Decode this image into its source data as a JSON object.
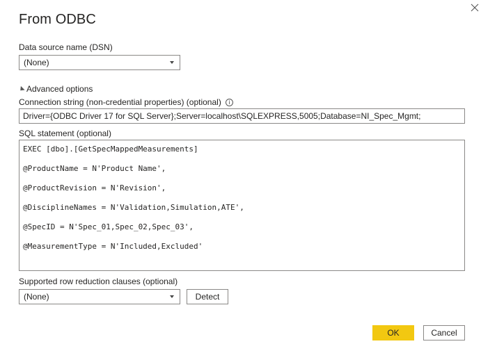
{
  "dialog": {
    "title": "From ODBC",
    "close_icon": "close-icon"
  },
  "dsn": {
    "label": "Data source name (DSN)",
    "value": "(None)"
  },
  "advanced": {
    "toggle_label": "Advanced options",
    "expanded": true
  },
  "connection": {
    "label": "Connection string (non-credential properties) (optional)",
    "info_glyph": "i",
    "value": "Driver={ODBC Driver 17 for SQL Server};Server=localhost\\SQLEXPRESS,5005;Database=NI_Spec_Mgmt;"
  },
  "sql": {
    "label": "SQL statement (optional)",
    "lines": [
      "EXEC [dbo].[GetSpecMappedMeasurements]",
      "@ProductName = N'Product Name',",
      "@ProductRevision = N'Revision',",
      "@DisciplineNames = N'Validation,Simulation,ATE',",
      "@SpecID = N'Spec_01,Spec_02,Spec_03',",
      "@MeasurementType = N'Included,Excluded'"
    ]
  },
  "row_reduction": {
    "label": "Supported row reduction clauses (optional)",
    "value": "(None)",
    "detect_label": "Detect"
  },
  "footer": {
    "ok_label": "OK",
    "cancel_label": "Cancel"
  },
  "colors": {
    "ok_button": "#f2c811",
    "border": "#8a8886",
    "text": "#252423"
  }
}
